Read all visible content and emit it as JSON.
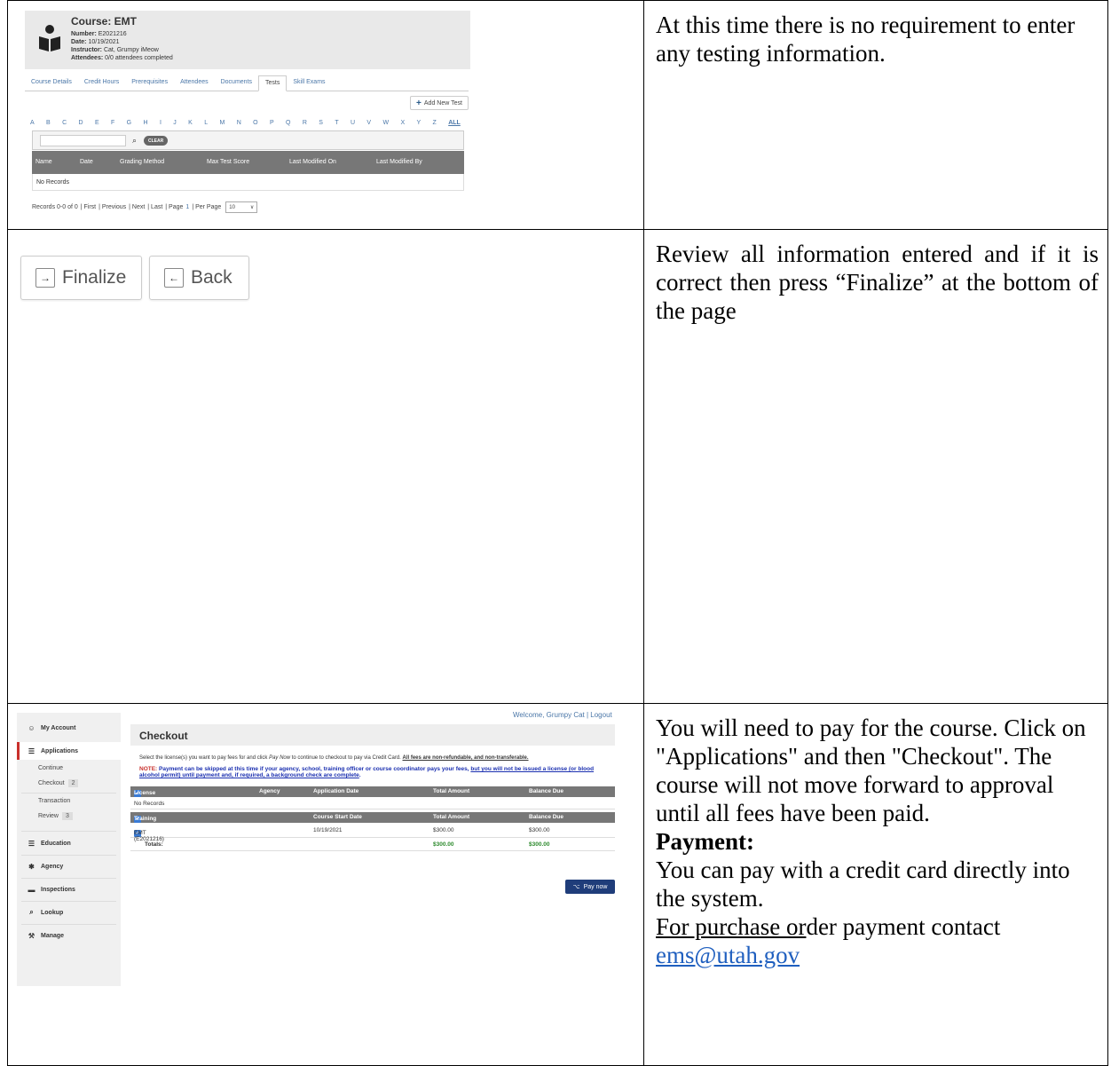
{
  "course_panel": {
    "title": "Course: EMT",
    "number_label": "Number:",
    "number_value": "E2021216",
    "date_label": "Date:",
    "date_value": "10/19/2021",
    "instructor_label": "Instructor:",
    "instructor_value": "Cat, Grumpy iMeow",
    "attendees_label": "Attendees:",
    "attendees_value": "0/0 attendees completed",
    "tabs": [
      "Course Details",
      "Credit Hours",
      "Prerequisites",
      "Attendees",
      "Documents",
      "Tests",
      "Skill Exams"
    ],
    "active_tab": "Tests",
    "add_test_label": "Add New Test",
    "alphabet": [
      "A",
      "B",
      "C",
      "D",
      "E",
      "F",
      "G",
      "H",
      "I",
      "J",
      "K",
      "L",
      "M",
      "N",
      "O",
      "P",
      "Q",
      "R",
      "S",
      "T",
      "U",
      "V",
      "W",
      "X",
      "Y",
      "Z"
    ],
    "alphabet_all": "ALL",
    "clear_label": "CLEAR",
    "columns": [
      "Name",
      "Date",
      "Grading Method",
      "Max Test Score",
      "Last Modified On",
      "Last Modified By"
    ],
    "no_records": "No Records",
    "pager": {
      "records": "Records 0-0 of 0",
      "first": "| First",
      "previous": "| Previous",
      "next": "| Next",
      "last": "| Last",
      "page_label": "| Page",
      "page_number": "1",
      "per_page_label": "| Per Page",
      "per_page_value": "10"
    }
  },
  "note1": "At this time there is no requirement to enter any testing information.",
  "buttons_panel": {
    "finalize_label": "Finalize",
    "back_label": "Back"
  },
  "note2": "Review all information entered and if it is correct then press “Finalize” at the bottom of the page",
  "checkout_panel": {
    "welcome": "Welcome, Grumpy Cat | Logout",
    "title": "Checkout",
    "sidebar": {
      "my_account": "My Account",
      "applications": "Applications",
      "continue": "Continue",
      "checkout": "Checkout",
      "checkout_count": "2",
      "transaction": "Transaction",
      "review": "Review",
      "review_count": "3",
      "education": "Education",
      "agency": "Agency",
      "inspections": "Inspections",
      "lookup": "Lookup",
      "manage": "Manage"
    },
    "instruction_prefix": "Select the license(s) you want to pay fees for and click ",
    "instruction_em": "Pay Now",
    "instruction_mid": " to continue to checkout to pay via Credit Card. ",
    "instruction_bold": "All fees are non-refundable, and non-transferable.",
    "note_label": "NOTE:",
    "note_text": " Payment can be skipped at this time if your agency, school, training officer or course coordinator pays your fees, ",
    "note_underlined": "but you will not be issued a license (or blood alcohol permit) until payment and, if required, a background check are complete",
    "note_end": ".",
    "license_header": [
      "License",
      "Agency",
      "Application Date",
      "Total Amount",
      "Balance Due"
    ],
    "license_no_records": "No Records",
    "training_header": [
      "Training",
      "Course Start Date",
      "Total Amount",
      "Balance Due"
    ],
    "training_row": {
      "name": "EMT (E2021216)",
      "start_date": "10/19/2021",
      "total": "$300.00",
      "balance": "$300.00"
    },
    "totals_label": "Totals:",
    "totals_total": "$300.00",
    "totals_balance": "$300.00",
    "pay_now_label": "Pay now"
  },
  "note3": {
    "intro": "You will need to pay for the course. Click on \"Applications\" and then \"Checkout\". The course will not move forward to approval until all fees have been paid.",
    "payment_heading": "Payment:",
    "payment_line": "You can pay with a credit card directly into the system.",
    "po_underlined": "For purchase or",
    "po_rest": "der payment contact",
    "email": "ems@utah.gov"
  }
}
